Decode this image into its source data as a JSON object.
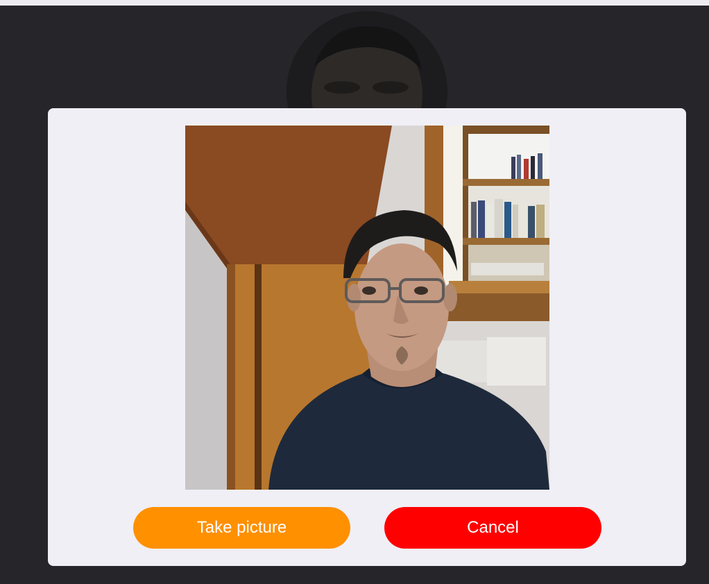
{
  "modal": {
    "take_picture_label": "Take picture",
    "cancel_label": "Cancel"
  },
  "colors": {
    "take_picture_button": "#ff9000",
    "cancel_button": "#ff0000",
    "modal_background": "#f0eff5",
    "page_background": "#26262a"
  },
  "icons": {
    "avatar": "profile-photo",
    "preview": "webcam-preview"
  }
}
